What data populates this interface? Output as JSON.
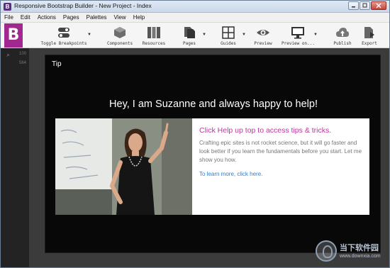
{
  "window": {
    "title": "Responsive Bootstrap Builder - New Project - Index",
    "controls": [
      "minimize",
      "maximize",
      "close"
    ]
  },
  "menu": {
    "items": [
      "File",
      "Edit",
      "Actions",
      "Pages",
      "Palettes",
      "View",
      "Help"
    ]
  },
  "toolbar": {
    "brand_letter": "B",
    "tools": [
      {
        "label": "Toggle Breakpoints",
        "icon": "toggle-icon"
      },
      {
        "label": "Components",
        "icon": "cube-icon"
      },
      {
        "label": "Resources",
        "icon": "books-icon"
      },
      {
        "label": "Pages",
        "icon": "pages-icon"
      },
      {
        "label": "Guides",
        "icon": "grid-icon"
      },
      {
        "label": "Preview",
        "icon": "eye-icon"
      },
      {
        "label": "Preview on...",
        "icon": "monitor-icon"
      },
      {
        "label": "Publish",
        "icon": "cloud-upload-icon"
      },
      {
        "label": "Export",
        "icon": "export-icon"
      }
    ]
  },
  "side_panel": {
    "rows": [
      "100",
      "564"
    ]
  },
  "tip_dialog": {
    "label": "Tip",
    "headline": "Hey, I am Suzanne and always happy to help!",
    "card_title": "Click Help up top to access tips & tricks.",
    "card_body": "Crafting epic sites is not rocket science, but it will go faster and look better if you learn the fundamentals before you start. Let me show you how.",
    "card_link": "To learn more, click here."
  },
  "watermark": {
    "text": "当下软件园",
    "url": "www.downxia.com"
  },
  "colors": {
    "brand": "#a0288e",
    "accent_title": "#c0339f",
    "link": "#2a7fd8",
    "dialog_bg": "#080808"
  }
}
